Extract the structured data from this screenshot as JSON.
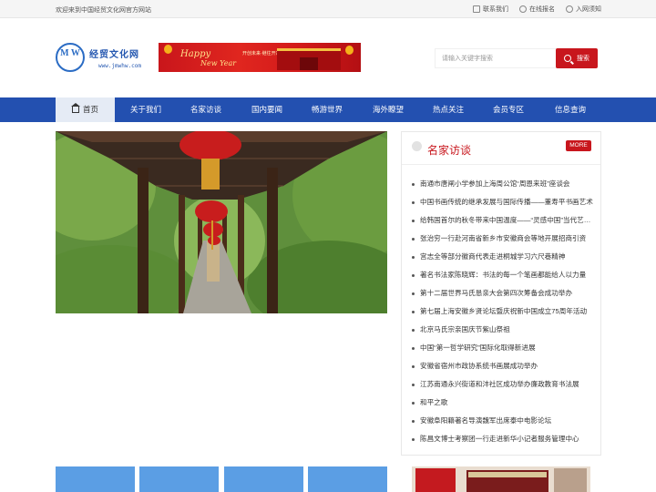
{
  "topbar": {
    "welcome": "欢迎来到中国经贸文化网官方网站",
    "links": [
      "联系我们",
      "在线报名",
      "入网须知"
    ]
  },
  "logo": {
    "monogram": "M W",
    "title": "经贸文化网",
    "url": "www.jmwhw.com"
  },
  "banner": {
    "line1": "Happy",
    "line2": "New Year",
    "slogan": "开创未来·继往开来"
  },
  "search": {
    "placeholder": "请输入关键字搜索",
    "button": "搜索"
  },
  "nav": {
    "items": [
      "首页",
      "关于我们",
      "名家访谈",
      "国内要闻",
      "畅游世界",
      "海外瞭望",
      "热点关注",
      "会员专区",
      "信息查询"
    ]
  },
  "panel": {
    "title": "名家访谈",
    "more": "MORE",
    "items": [
      "南通市唐闸小学参加上海周公馆“周恩来班”座谈会",
      "中国书画传统的继承发展与国际传播——董寿平书画艺术",
      "给韩国首尔的秋冬带来中国温度——“灵感中国”当代艺术展",
      "张治穷一行赴河南省新乡市安徽商会等地开展招商引资",
      "宫志全等部分徽商代表走进桐城学习六尺巷精神",
      "著名书法家陈晓辉：书法的每一个笔画都能给人以力量",
      "第十二届世界马氏恳亲大会第四次筹备会成功举办",
      "第七届上海安徽乡贤论坛暨庆祝新中国成立75周年活动",
      "北京马氏宗亲国庆节紫山祭祖",
      "中国“第一哲学研究”国际化取得新进展",
      "安徽省宿州市政协系统书画展成功举办",
      "江苏南通永兴街道和沣社区成功举办廉政教育书法展",
      "和平之歌",
      "安徽阜阳籍著名导演魏军出席泰中电影论坛",
      "陈昌文博士考察团一行走进新华小记者服务管理中心"
    ]
  },
  "colors": {
    "nav_bg": "#2350b0",
    "accent_red": "#c8161d",
    "tile_blue": "#5b9ee4"
  }
}
